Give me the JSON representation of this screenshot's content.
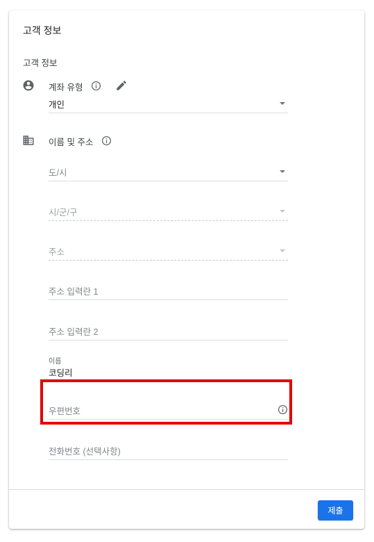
{
  "card": {
    "title": "고객 정보",
    "section_title": "고객 정보"
  },
  "account_type": {
    "label": "계좌 유형",
    "value": "개인"
  },
  "name_address": {
    "label": "이름 및 주소",
    "province_placeholder": "도/시",
    "city_placeholder": "시/군/구",
    "address_placeholder": "주소",
    "address_line1_placeholder": "주소 입력란 1",
    "address_line2_placeholder": "주소 입력란 2",
    "name_label": "이름",
    "name_value": "코딩리",
    "postal_placeholder": "우편번호",
    "phone_placeholder": "전화번호 (선택사항)"
  },
  "footer": {
    "submit_label": "제출",
    "submit_color": "#1a73e8"
  },
  "highlight_color": "#e30000"
}
